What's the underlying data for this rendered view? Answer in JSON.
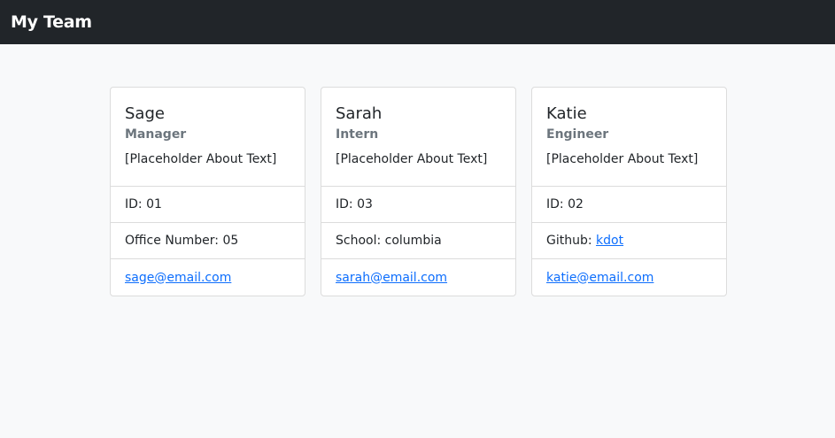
{
  "navbar": {
    "title": "My Team"
  },
  "colors": {
    "navbar": "#212529",
    "link": "#0d6efd",
    "muted": "#6c757d",
    "background": "#f8f9fa"
  },
  "cards": [
    {
      "name": "Sage",
      "role": "Manager",
      "about": "[Placeholder About Text]",
      "id": "ID: 01",
      "extra_label": "Office Number: ",
      "extra_value": "05",
      "extra_link": false,
      "email": "sage@email.com"
    },
    {
      "name": "Sarah",
      "role": "Intern",
      "about": "[Placeholder About Text]",
      "id": "ID: 03",
      "extra_label": "School: ",
      "extra_value": "columbia",
      "extra_link": false,
      "email": "sarah@email.com"
    },
    {
      "name": "Katie",
      "role": "Engineer",
      "about": "[Placeholder About Text]",
      "id": "ID: 02",
      "extra_label": "Github: ",
      "extra_value": "kdot",
      "extra_link": true,
      "email": "katie@email.com"
    }
  ]
}
